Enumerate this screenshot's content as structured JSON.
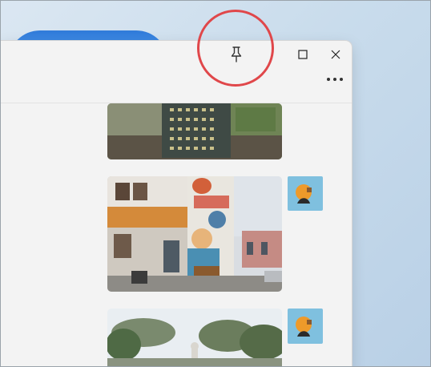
{
  "window": {
    "caption_buttons": [
      {
        "name": "pin",
        "icon": "pin-icon"
      },
      {
        "name": "maximize",
        "icon": "maximize-icon"
      },
      {
        "name": "close",
        "icon": "close-icon"
      }
    ],
    "more_options_icon": "more-horizontal-icon"
  },
  "annotation": {
    "color": "#e0474a",
    "target": "pin-button"
  },
  "gallery": {
    "photos": [
      {
        "name": "stone-monument-photo",
        "partially_visible": true
      },
      {
        "name": "mural-building-photo",
        "partially_visible": false
      },
      {
        "name": "trees-statue-photo",
        "partially_visible": true
      }
    ],
    "thumbnails": [
      {
        "name": "orange-fruit-thumbnail"
      },
      {
        "name": "orange-fruit-thumbnail"
      }
    ]
  },
  "colors": {
    "window_background": "#f3f3f3",
    "annotation_red": "#e0474a",
    "wallpaper_blue": "#2f7ad9"
  }
}
